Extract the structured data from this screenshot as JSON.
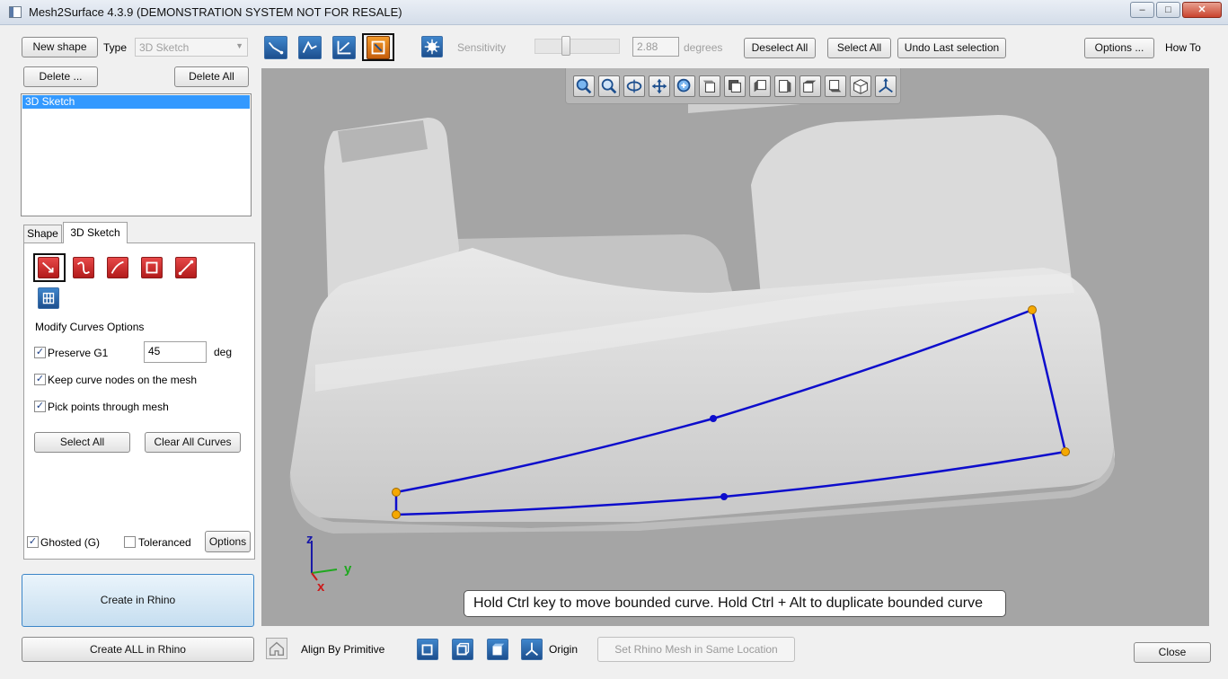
{
  "window": {
    "title": "Mesh2Surface 4.3.9 (DEMONSTRATION SYSTEM NOT FOR RESALE)",
    "minimize": "–",
    "maximize": "□",
    "close": "✕"
  },
  "toolbar": {
    "new_shape": "New shape",
    "type_label": "Type",
    "type_value": "3D Sketch",
    "sensitivity_label": "Sensitivity",
    "sensitivity_value": "2.88",
    "sensitivity_unit": "degrees",
    "deselect_all": "Deselect All",
    "select_all": "Select All",
    "undo_last": "Undo Last selection",
    "options": "Options ...",
    "how_to": "How To"
  },
  "left": {
    "delete": "Delete ...",
    "delete_all": "Delete All",
    "shapes": [
      "3D Sketch"
    ],
    "tabs": [
      "Shape",
      "3D Sketch"
    ],
    "modify_title": "Modify Curves Options",
    "preserve_g1": "Preserve G1",
    "preserve_g1_value": "45",
    "deg": "deg",
    "keep_nodes": "Keep curve nodes on the mesh",
    "pick_points": "Pick points through mesh",
    "select_all": "Select All",
    "clear_all": "Clear All Curves",
    "ghosted": "Ghosted (G)",
    "toleranced": "Toleranced",
    "options": "Options",
    "create": "Create in Rhino",
    "create_all": "Create ALL in Rhino",
    "check_mark": "✓"
  },
  "viewport": {
    "hint": "Hold Ctrl key to move bounded curve. Hold Ctrl + Alt to duplicate bounded curve",
    "axis_z": "z",
    "axis_y": "y",
    "axis_x": "x",
    "colors": {
      "curve": "#0d0dcc",
      "node": "#f5a800",
      "background": "#a5a5a5"
    }
  },
  "bottom": {
    "align": "Align By Primitive",
    "origin": "Origin",
    "set_rhino": "Set Rhino Mesh in Same Location",
    "close": "Close"
  }
}
